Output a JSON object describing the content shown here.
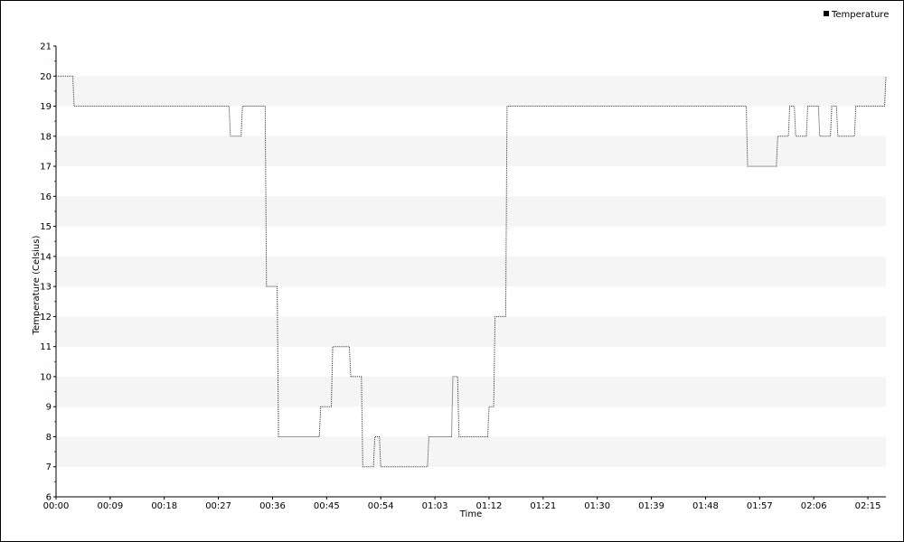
{
  "chart_data": {
    "type": "line",
    "title": "",
    "xlabel": "Time",
    "ylabel": "Temperature (Celsius)",
    "ylim": [
      6,
      21
    ],
    "xlim_minutes": [
      0,
      138
    ],
    "grid": "alternating horizontal bands",
    "legend_position": "top-right",
    "x_tick_labels": [
      "00:00",
      "00:09",
      "00:18",
      "00:27",
      "00:36",
      "00:45",
      "00:54",
      "01:03",
      "01:12",
      "01:21",
      "01:30",
      "01:39",
      "01:48",
      "01:57",
      "02:06",
      "02:15"
    ],
    "y_tick_labels": [
      "6",
      "7",
      "8",
      "9",
      "10",
      "11",
      "12",
      "13",
      "14",
      "15",
      "16",
      "17",
      "18",
      "19",
      "20",
      "21"
    ],
    "series": [
      {
        "name": "Temperature",
        "color": "#333333",
        "style": "dotted",
        "x": [
          "00:00",
          "00:03",
          "00:29",
          "00:30",
          "00:31",
          "00:35",
          "00:36",
          "00:37",
          "00:44",
          "00:45",
          "00:46",
          "00:48",
          "00:49",
          "00:50",
          "00:51",
          "00:52",
          "00:53",
          "00:54",
          "01:02",
          "01:03",
          "01:05",
          "01:06",
          "01:07",
          "01:12",
          "01:13",
          "01:14",
          "01:15",
          "01:55",
          "01:56",
          "02:00",
          "02:01",
          "02:02",
          "02:03",
          "02:04",
          "02:05",
          "02:07",
          "02:08",
          "02:09",
          "02:10",
          "02:12",
          "02:13",
          "02:14",
          "02:18"
        ],
        "values": [
          20,
          19,
          18,
          18,
          19,
          13,
          13,
          8,
          9,
          9,
          11,
          11,
          10,
          10,
          7,
          7,
          8,
          7,
          8,
          8,
          8,
          10,
          8,
          9,
          12,
          12,
          19,
          17,
          17,
          18,
          18,
          19,
          18,
          18,
          19,
          18,
          18,
          19,
          18,
          18,
          19,
          19,
          20
        ]
      }
    ]
  }
}
